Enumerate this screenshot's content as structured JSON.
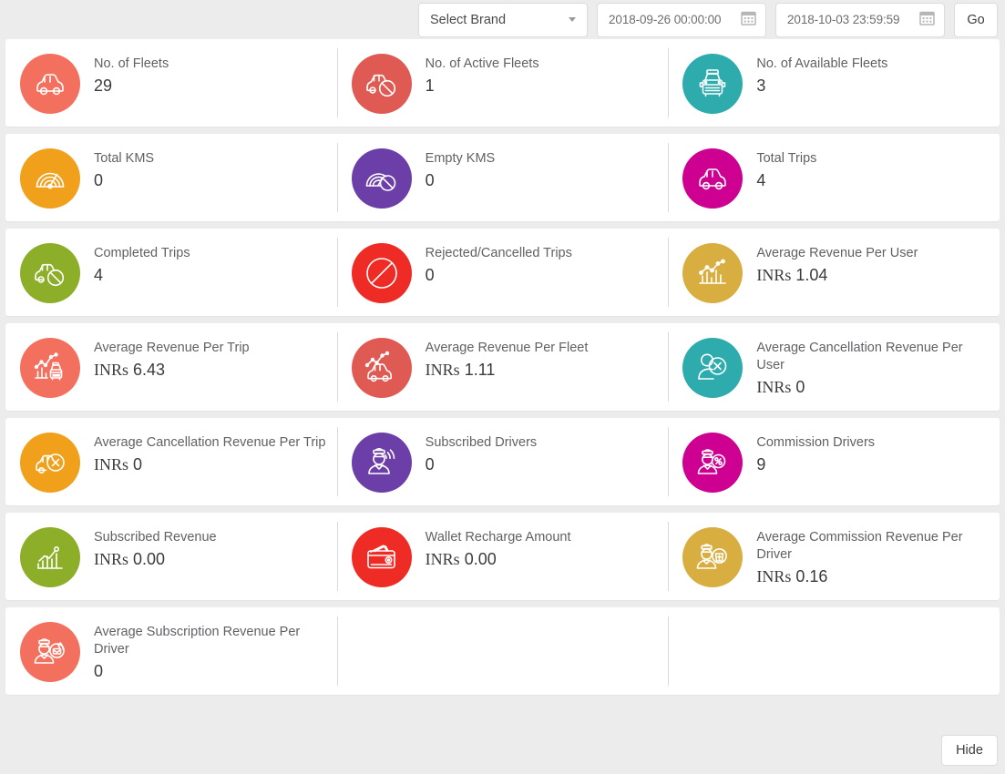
{
  "toolbar": {
    "brand_select": {
      "value": "Select Brand",
      "icon": "chevron-down-icon"
    },
    "start_date": {
      "value": "2018-09-26 00:00:00",
      "icon": "calendar-icon"
    },
    "end_date": {
      "value": "2018-10-03 23:59:59",
      "icon": "calendar-icon"
    },
    "go_label": "Go"
  },
  "footer": {
    "hide_label": "Hide"
  },
  "colors": {
    "salmon": "#F4705E",
    "red_muted": "#DF5A52",
    "teal": "#2EABAC",
    "orange": "#F0A01B",
    "purple": "#6C3FA8",
    "magenta": "#CE0091",
    "olive": "#8DAE28",
    "red": "#EE2B24",
    "gold": "#D9AE41",
    "page_bg": "#ECECEC",
    "card_bg": "#FFFFFF"
  },
  "rows": [
    {
      "tall": false,
      "cards": [
        {
          "title": "No. of Fleets",
          "value": "29",
          "currency": "",
          "color": "#F4705E",
          "icon": "car-icon"
        },
        {
          "title": "No. of Active Fleets",
          "value": "1",
          "currency": "",
          "color": "#DF5A52",
          "icon": "car-blocked-icon"
        },
        {
          "title": "No. of Available Fleets",
          "value": "3",
          "currency": "",
          "color": "#2EABAC",
          "icon": "taxi-front-icon"
        }
      ]
    },
    {
      "tall": false,
      "cards": [
        {
          "title": "Total KMS",
          "value": "0",
          "currency": "",
          "color": "#F0A01B",
          "icon": "speedometer-icon"
        },
        {
          "title": "Empty KMS",
          "value": "0",
          "currency": "",
          "color": "#6C3FA8",
          "icon": "speedometer-blocked-icon"
        },
        {
          "title": "Total Trips",
          "value": "4",
          "currency": "",
          "color": "#CE0091",
          "icon": "car-icon"
        }
      ]
    },
    {
      "tall": false,
      "cards": [
        {
          "title": "Completed Trips",
          "value": "4",
          "currency": "",
          "color": "#8DAE28",
          "icon": "car-blocked-icon"
        },
        {
          "title": "Rejected/Cancelled Trips",
          "value": "0",
          "currency": "",
          "color": "#EE2B24",
          "icon": "no-entry-icon"
        },
        {
          "title": "Average Revenue Per User",
          "value": "1.04",
          "currency": "INRs",
          "color": "#D9AE41",
          "icon": "bar-chart-trend-icon"
        }
      ]
    },
    {
      "tall": true,
      "cards": [
        {
          "title": "Average Revenue Per Trip",
          "value": "6.43",
          "currency": "INRs",
          "color": "#F4705E",
          "icon": "chart-taxi-icon"
        },
        {
          "title": "Average Revenue Per Fleet",
          "value": "1.11",
          "currency": "INRs",
          "color": "#DF5A52",
          "icon": "chart-car-icon"
        },
        {
          "title": "Average Cancellation Revenue Per User",
          "value": "0",
          "currency": "INRs",
          "color": "#2EABAC",
          "icon": "user-cancel-icon"
        }
      ]
    },
    {
      "tall": true,
      "cards": [
        {
          "title": "Average Cancellation Revenue Per Trip",
          "value": "0",
          "currency": "INRs",
          "color": "#F0A01B",
          "icon": "car-cancel-icon"
        },
        {
          "title": "Subscribed Drivers",
          "value": "0",
          "currency": "",
          "color": "#6C3FA8",
          "icon": "driver-signal-icon"
        },
        {
          "title": "Commission Drivers",
          "value": "9",
          "currency": "",
          "color": "#CE0091",
          "icon": "driver-percent-icon"
        }
      ]
    },
    {
      "tall": true,
      "cards": [
        {
          "title": "Subscribed Revenue",
          "value": "0.00",
          "currency": "INRs",
          "color": "#8DAE28",
          "icon": "bar-chart-icon"
        },
        {
          "title": "Wallet Recharge Amount",
          "value": "0.00",
          "currency": "INRs",
          "color": "#EE2B24",
          "icon": "wallet-icon"
        },
        {
          "title": "Average Commission Revenue Per Driver",
          "value": "0.16",
          "currency": "INRs",
          "color": "#D9AE41",
          "icon": "driver-money-icon"
        }
      ]
    },
    {
      "tall": true,
      "cards": [
        {
          "title": "Average Subscription Revenue Per Driver",
          "value": "0",
          "currency": "",
          "color": "#F4705E",
          "icon": "driver-signal-badge-icon"
        },
        {
          "title": "",
          "value": "",
          "currency": "",
          "color": "",
          "icon": ""
        },
        {
          "title": "",
          "value": "",
          "currency": "",
          "color": "",
          "icon": ""
        }
      ]
    }
  ]
}
